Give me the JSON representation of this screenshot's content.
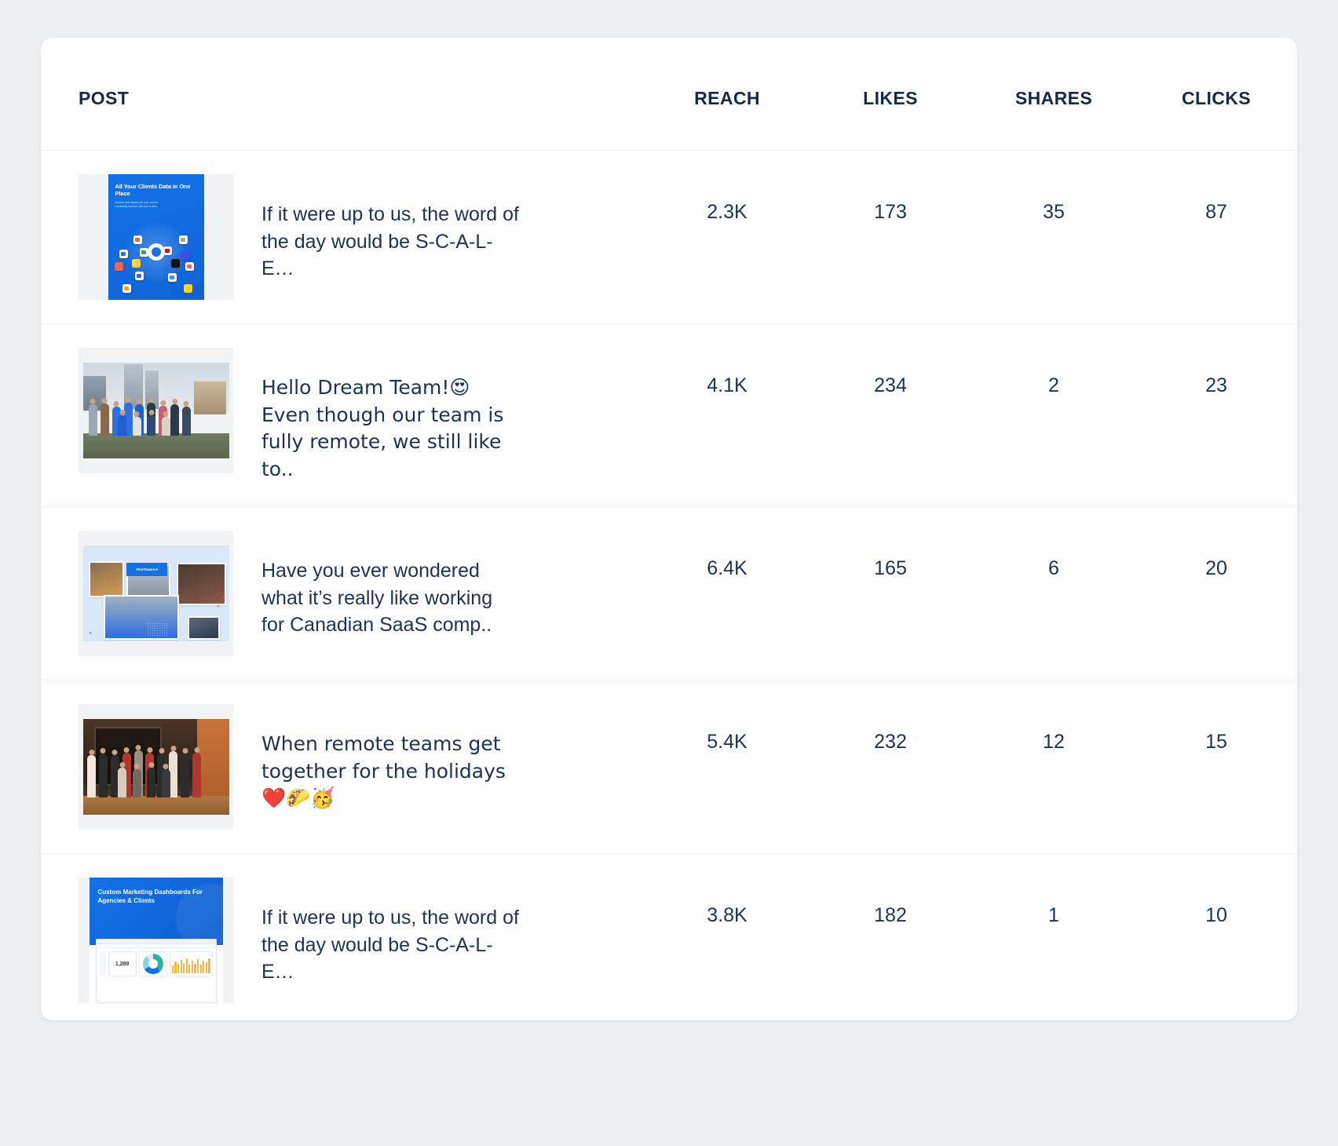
{
  "table": {
    "columns": [
      {
        "key": "post",
        "label": "POST"
      },
      {
        "key": "reach",
        "label": "REACH"
      },
      {
        "key": "likes",
        "label": "LIKES"
      },
      {
        "key": "shares",
        "label": "SHARES"
      },
      {
        "key": "clicks",
        "label": "CLICKS"
      }
    ],
    "rows": [
      {
        "thumbnail": {
          "type": "promo-graphic",
          "headline": "All Your Clients Data in One Place",
          "subtext": "Access and display all your clients marketing metrics with just a click.",
          "background_color": "#1372e8"
        },
        "title": "If it were up to us, the word of the day would be S-C-A-L-E…",
        "reach": "2.3K",
        "likes": "173",
        "shares": "35",
        "clicks": "87"
      },
      {
        "thumbnail": {
          "type": "team-photo-outdoor",
          "headline": "",
          "subtext": "",
          "background_color": "#cfd9e2"
        },
        "title": "Hello Dream Team!😍 Even though our team is fully remote, we still like to..",
        "reach": "4.1K",
        "likes": "234",
        "shares": "2",
        "clicks": "23"
      },
      {
        "thumbnail": {
          "type": "photo-collage",
          "headline": "#GoTeamAA",
          "subtext": "",
          "background_color": "#dbe8fb"
        },
        "title": "Have you ever wondered what it’s really like working for Canadian SaaS comp..",
        "reach": "6.4K",
        "likes": "165",
        "shares": "6",
        "clicks": "20"
      },
      {
        "thumbnail": {
          "type": "team-photo-indoor",
          "headline": "",
          "subtext": "",
          "background_color": "#4b3526"
        },
        "title": "When remote teams get together for the holidays ❤️🌮🥳",
        "reach": "5.4K",
        "likes": "232",
        "shares": "12",
        "clicks": "15"
      },
      {
        "thumbnail": {
          "type": "dashboard-promo",
          "headline": "Custom Marketing Dashboards For Agencies & Clients",
          "subtext": "1,289",
          "background_color": "#1372e8"
        },
        "title": "If it were up to us, the word of the day would be S-C-A-L-E…",
        "reach": "3.8K",
        "likes": "182",
        "shares": "1",
        "clicks": "10"
      }
    ]
  },
  "colors": {
    "page_background": "#eceef1",
    "card_background": "#ffffff",
    "text_primary": "#1c3454",
    "header_text": "#152a47",
    "row_divider": "#eef0f3",
    "thumb_frame": "#f2f3f5",
    "brand_blue": "#1372e8"
  }
}
